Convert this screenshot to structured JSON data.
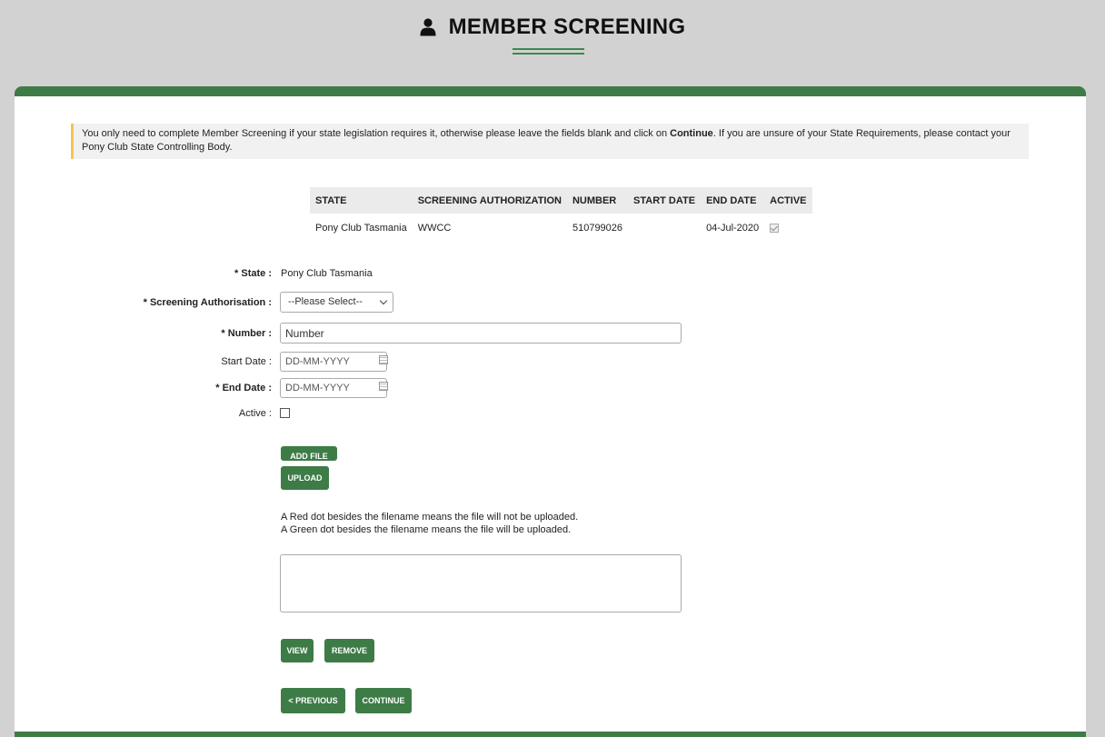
{
  "header": {
    "title": "MEMBER SCREENING",
    "icon": "user-icon"
  },
  "notice": {
    "text_before": "You only need to complete Member Screening if your state legislation requires it, otherwise please leave the fields blank and click on ",
    "bold": "Continue",
    "text_after": ". If you are unsure of your State Requirements, please contact your Pony Club State Controlling Body."
  },
  "table": {
    "columns": [
      "STATE",
      "SCREENING AUTHORIZATION",
      "NUMBER",
      "START DATE",
      "END DATE",
      "ACTIVE"
    ],
    "rows": [
      {
        "state": "Pony Club Tasmania",
        "authorization": "WWCC",
        "number": "510799026",
        "start_date": "",
        "end_date": "04-Jul-2020",
        "active": true
      }
    ]
  },
  "form": {
    "state_label": "State :",
    "state_value": "Pony Club Tasmania",
    "auth_label": "Screening Authorisation :",
    "auth_selected": "--Please Select--",
    "number_label": "Number :",
    "number_value": "Number",
    "start_label": "Start Date :",
    "start_placeholder": "DD-MM-YYYY",
    "end_label": "End Date :",
    "end_placeholder": "DD-MM-YYYY",
    "active_label": "Active :",
    "required_mark": "*"
  },
  "buttons": {
    "add_file": "ADD FILE",
    "upload": "UPLOAD",
    "view": "VIEW",
    "remove": "REMOVE",
    "previous": "< PREVIOUS",
    "continue": "CONTINUE"
  },
  "info": {
    "line1": "A Red dot besides the filename means the file will not be uploaded.",
    "line2": "A Green dot besides the filename means the file will be uploaded."
  },
  "colors": {
    "accent": "#3d7c47",
    "notice_border": "#f0c84a"
  }
}
